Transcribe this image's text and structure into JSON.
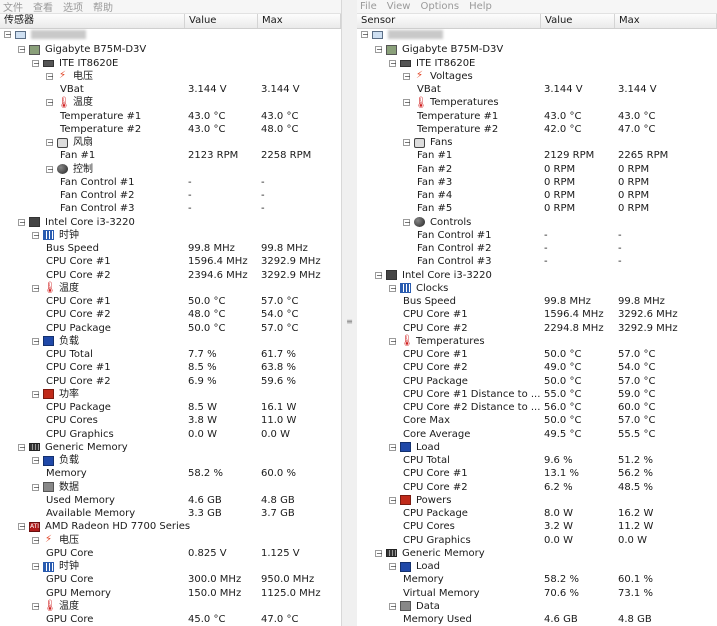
{
  "left": {
    "menu": [
      "文件",
      "查看",
      "选项",
      "帮助"
    ],
    "columns": {
      "sensor": "传感器",
      "value": "Value",
      "max": "Max"
    },
    "rows": [
      {
        "d": 0,
        "exp": "-",
        "icon": "computer",
        "name": ""
      },
      {
        "d": 1,
        "exp": "-",
        "icon": "mobo",
        "name": "Gigabyte B75M-D3V"
      },
      {
        "d": 2,
        "exp": "-",
        "icon": "chip",
        "name": "ITE IT8620E"
      },
      {
        "d": 3,
        "exp": "-",
        "icon": "volt",
        "name": "电压"
      },
      {
        "d": 4,
        "name": "VBat",
        "v": "3.144 V",
        "m": "3.144 V"
      },
      {
        "d": 3,
        "exp": "-",
        "icon": "temp",
        "name": "温度"
      },
      {
        "d": 4,
        "name": "Temperature #1",
        "v": "43.0 °C",
        "m": "43.0 °C"
      },
      {
        "d": 4,
        "name": "Temperature #2",
        "v": "43.0 °C",
        "m": "48.0 °C"
      },
      {
        "d": 3,
        "exp": "-",
        "icon": "fan",
        "name": "风扇"
      },
      {
        "d": 4,
        "name": "Fan #1",
        "v": "2123 RPM",
        "m": "2258 RPM"
      },
      {
        "d": 3,
        "exp": "-",
        "icon": "ctrl",
        "name": "控制"
      },
      {
        "d": 4,
        "name": "Fan Control #1",
        "v": "-",
        "m": "-"
      },
      {
        "d": 4,
        "name": "Fan Control #2",
        "v": "-",
        "m": "-"
      },
      {
        "d": 4,
        "name": "Fan Control #3",
        "v": "-",
        "m": "-"
      },
      {
        "d": 1,
        "exp": "-",
        "icon": "cpu",
        "name": "Intel Core i3-3220"
      },
      {
        "d": 2,
        "exp": "-",
        "icon": "clock",
        "name": "时钟"
      },
      {
        "d": 3,
        "name": "Bus Speed",
        "v": "99.8 MHz",
        "m": "99.8 MHz"
      },
      {
        "d": 3,
        "name": "CPU Core #1",
        "v": "1596.4 MHz",
        "m": "3292.9 MHz"
      },
      {
        "d": 3,
        "name": "CPU Core #2",
        "v": "2394.6 MHz",
        "m": "3292.9 MHz"
      },
      {
        "d": 2,
        "exp": "-",
        "icon": "temp",
        "name": "温度"
      },
      {
        "d": 3,
        "name": "CPU Core #1",
        "v": "50.0 °C",
        "m": "57.0 °C"
      },
      {
        "d": 3,
        "name": "CPU Core #2",
        "v": "48.0 °C",
        "m": "54.0 °C"
      },
      {
        "d": 3,
        "name": "CPU Package",
        "v": "50.0 °C",
        "m": "57.0 °C"
      },
      {
        "d": 2,
        "exp": "-",
        "icon": "load",
        "name": "负载"
      },
      {
        "d": 3,
        "name": "CPU Total",
        "v": "7.7 %",
        "m": "61.7 %"
      },
      {
        "d": 3,
        "name": "CPU Core #1",
        "v": "8.5 %",
        "m": "63.8 %"
      },
      {
        "d": 3,
        "name": "CPU Core #2",
        "v": "6.9 %",
        "m": "59.6 %"
      },
      {
        "d": 2,
        "exp": "-",
        "icon": "power",
        "name": "功率"
      },
      {
        "d": 3,
        "name": "CPU Package",
        "v": "8.5 W",
        "m": "16.1 W"
      },
      {
        "d": 3,
        "name": "CPU Cores",
        "v": "3.8 W",
        "m": "11.0 W"
      },
      {
        "d": 3,
        "name": "CPU Graphics",
        "v": "0.0 W",
        "m": "0.0 W"
      },
      {
        "d": 1,
        "exp": "-",
        "icon": "mem",
        "name": "Generic Memory"
      },
      {
        "d": 2,
        "exp": "-",
        "icon": "load",
        "name": "负载"
      },
      {
        "d": 3,
        "name": "Memory",
        "v": "58.2 %",
        "m": "60.0 %"
      },
      {
        "d": 2,
        "exp": "-",
        "icon": "data",
        "name": "数据"
      },
      {
        "d": 3,
        "name": "Used Memory",
        "v": "4.6 GB",
        "m": "4.8 GB"
      },
      {
        "d": 3,
        "name": "Available Memory",
        "v": "3.3 GB",
        "m": "3.7 GB"
      },
      {
        "d": 1,
        "exp": "-",
        "icon": "gpu",
        "name": "AMD Radeon HD 7700 Series"
      },
      {
        "d": 2,
        "exp": "-",
        "icon": "volt",
        "name": "电压"
      },
      {
        "d": 3,
        "name": "GPU Core",
        "v": "0.825 V",
        "m": "1.125 V"
      },
      {
        "d": 2,
        "exp": "-",
        "icon": "clock",
        "name": "时钟"
      },
      {
        "d": 3,
        "name": "GPU Core",
        "v": "300.0 MHz",
        "m": "950.0 MHz"
      },
      {
        "d": 3,
        "name": "GPU Memory",
        "v": "150.0 MHz",
        "m": "1125.0 MHz"
      },
      {
        "d": 2,
        "exp": "-",
        "icon": "temp",
        "name": "温度"
      },
      {
        "d": 3,
        "name": "GPU Core",
        "v": "45.0 °C",
        "m": "47.0 °C"
      }
    ]
  },
  "right": {
    "menu": [
      "File",
      "View",
      "Options",
      "Help"
    ],
    "columns": {
      "sensor": "Sensor",
      "value": "Value",
      "max": "Max"
    },
    "rows": [
      {
        "d": 0,
        "exp": "-",
        "icon": "computer",
        "name": ""
      },
      {
        "d": 1,
        "exp": "-",
        "icon": "mobo",
        "name": "Gigabyte B75M-D3V"
      },
      {
        "d": 2,
        "exp": "-",
        "icon": "chip",
        "name": "ITE IT8620E"
      },
      {
        "d": 3,
        "exp": "-",
        "icon": "volt",
        "name": "Voltages"
      },
      {
        "d": 4,
        "name": "VBat",
        "v": "3.144 V",
        "m": "3.144 V"
      },
      {
        "d": 3,
        "exp": "-",
        "icon": "temp",
        "name": "Temperatures"
      },
      {
        "d": 4,
        "name": "Temperature #1",
        "v": "43.0 °C",
        "m": "43.0 °C"
      },
      {
        "d": 4,
        "name": "Temperature #2",
        "v": "42.0 °C",
        "m": "47.0 °C"
      },
      {
        "d": 3,
        "exp": "-",
        "icon": "fan",
        "name": "Fans"
      },
      {
        "d": 4,
        "name": "Fan #1",
        "v": "2129 RPM",
        "m": "2265 RPM"
      },
      {
        "d": 4,
        "name": "Fan #2",
        "v": "0 RPM",
        "m": "0 RPM"
      },
      {
        "d": 4,
        "name": "Fan #3",
        "v": "0 RPM",
        "m": "0 RPM"
      },
      {
        "d": 4,
        "name": "Fan #4",
        "v": "0 RPM",
        "m": "0 RPM"
      },
      {
        "d": 4,
        "name": "Fan #5",
        "v": "0 RPM",
        "m": "0 RPM"
      },
      {
        "d": 3,
        "exp": "-",
        "icon": "ctrl",
        "name": "Controls"
      },
      {
        "d": 4,
        "name": "Fan Control #1",
        "v": "-",
        "m": "-"
      },
      {
        "d": 4,
        "name": "Fan Control #2",
        "v": "-",
        "m": "-"
      },
      {
        "d": 4,
        "name": "Fan Control #3",
        "v": "-",
        "m": "-"
      },
      {
        "d": 1,
        "exp": "-",
        "icon": "cpu",
        "name": "Intel Core i3-3220"
      },
      {
        "d": 2,
        "exp": "-",
        "icon": "clock",
        "name": "Clocks"
      },
      {
        "d": 3,
        "name": "Bus Speed",
        "v": "99.8 MHz",
        "m": "99.8 MHz"
      },
      {
        "d": 3,
        "name": "CPU Core #1",
        "v": "1596.4 MHz",
        "m": "3292.6 MHz"
      },
      {
        "d": 3,
        "name": "CPU Core #2",
        "v": "2294.8 MHz",
        "m": "3292.9 MHz"
      },
      {
        "d": 2,
        "exp": "-",
        "icon": "temp",
        "name": "Temperatures"
      },
      {
        "d": 3,
        "name": "CPU Core #1",
        "v": "50.0 °C",
        "m": "57.0 °C"
      },
      {
        "d": 3,
        "name": "CPU Core #2",
        "v": "49.0 °C",
        "m": "54.0 °C"
      },
      {
        "d": 3,
        "name": "CPU Package",
        "v": "50.0 °C",
        "m": "57.0 °C"
      },
      {
        "d": 3,
        "name": "CPU Core #1 Distance to ...",
        "v": "55.0 °C",
        "m": "59.0 °C"
      },
      {
        "d": 3,
        "name": "CPU Core #2 Distance to ...",
        "v": "56.0 °C",
        "m": "60.0 °C"
      },
      {
        "d": 3,
        "name": "Core Max",
        "v": "50.0 °C",
        "m": "57.0 °C"
      },
      {
        "d": 3,
        "name": "Core Average",
        "v": "49.5 °C",
        "m": "55.5 °C"
      },
      {
        "d": 2,
        "exp": "-",
        "icon": "load",
        "name": "Load"
      },
      {
        "d": 3,
        "name": "CPU Total",
        "v": "9.6 %",
        "m": "51.2 %"
      },
      {
        "d": 3,
        "name": "CPU Core #1",
        "v": "13.1 %",
        "m": "56.2 %"
      },
      {
        "d": 3,
        "name": "CPU Core #2",
        "v": "6.2 %",
        "m": "48.5 %"
      },
      {
        "d": 2,
        "exp": "-",
        "icon": "power",
        "name": "Powers"
      },
      {
        "d": 3,
        "name": "CPU Package",
        "v": "8.0 W",
        "m": "16.2 W"
      },
      {
        "d": 3,
        "name": "CPU Cores",
        "v": "3.2 W",
        "m": "11.2 W"
      },
      {
        "d": 3,
        "name": "CPU Graphics",
        "v": "0.0 W",
        "m": "0.0 W"
      },
      {
        "d": 1,
        "exp": "-",
        "icon": "mem",
        "name": "Generic Memory"
      },
      {
        "d": 2,
        "exp": "-",
        "icon": "load",
        "name": "Load"
      },
      {
        "d": 3,
        "name": "Memory",
        "v": "58.2 %",
        "m": "60.1 %"
      },
      {
        "d": 3,
        "name": "Virtual Memory",
        "v": "70.6 %",
        "m": "73.1 %"
      },
      {
        "d": 2,
        "exp": "-",
        "icon": "data",
        "name": "Data"
      },
      {
        "d": 3,
        "name": "Memory Used",
        "v": "4.6 GB",
        "m": "4.8 GB"
      }
    ]
  },
  "icons": {
    "computer": "computer-icon",
    "mobo": "motherboard-icon",
    "chip": "chip-icon",
    "volt": "voltage-icon",
    "temp": "temperature-icon",
    "fan": "fan-icon",
    "ctrl": "control-icon",
    "cpu": "cpu-icon",
    "clock": "clock-icon",
    "load": "load-icon",
    "power": "power-icon",
    "mem": "memory-icon",
    "data": "data-icon",
    "gpu": "gpu-icon"
  }
}
